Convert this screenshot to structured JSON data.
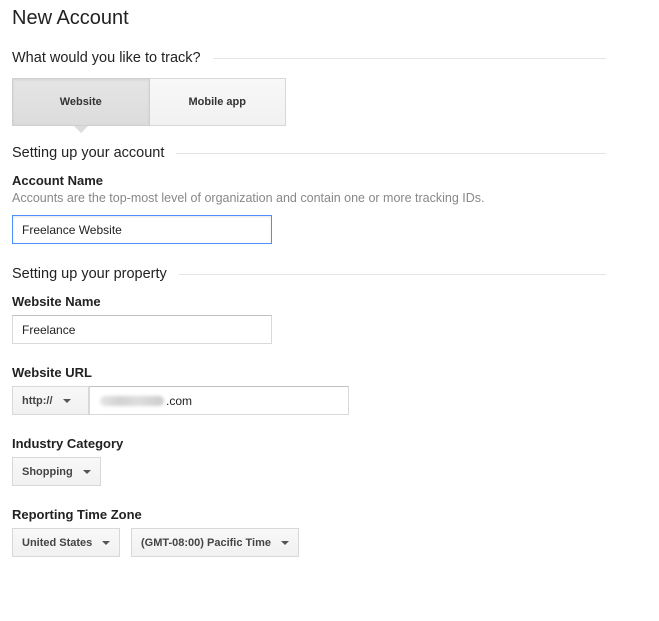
{
  "page": {
    "title": "New Account"
  },
  "track_section": {
    "heading": "What would you like to track?",
    "options": [
      {
        "label": "Website",
        "selected": true
      },
      {
        "label": "Mobile app",
        "selected": false
      }
    ]
  },
  "account_section": {
    "heading": "Setting up your account",
    "name_label": "Account Name",
    "name_help": "Accounts are the top-most level of organization and contain one or more tracking IDs.",
    "name_value": "Freelance Website"
  },
  "property_section": {
    "heading": "Setting up your property",
    "website_name_label": "Website Name",
    "website_name_value": "Freelance",
    "url_label": "Website URL",
    "protocol_value": "http://",
    "url_suffix": ".com",
    "industry_label": "Industry Category",
    "industry_value": "Shopping",
    "timezone_label": "Reporting Time Zone",
    "country_value": "United States",
    "timezone_value": "(GMT-08:00) Pacific Time"
  },
  "colors": {
    "focus_border": "#4d90fe",
    "rule": "#e5e5e5",
    "help_text": "#888888"
  }
}
